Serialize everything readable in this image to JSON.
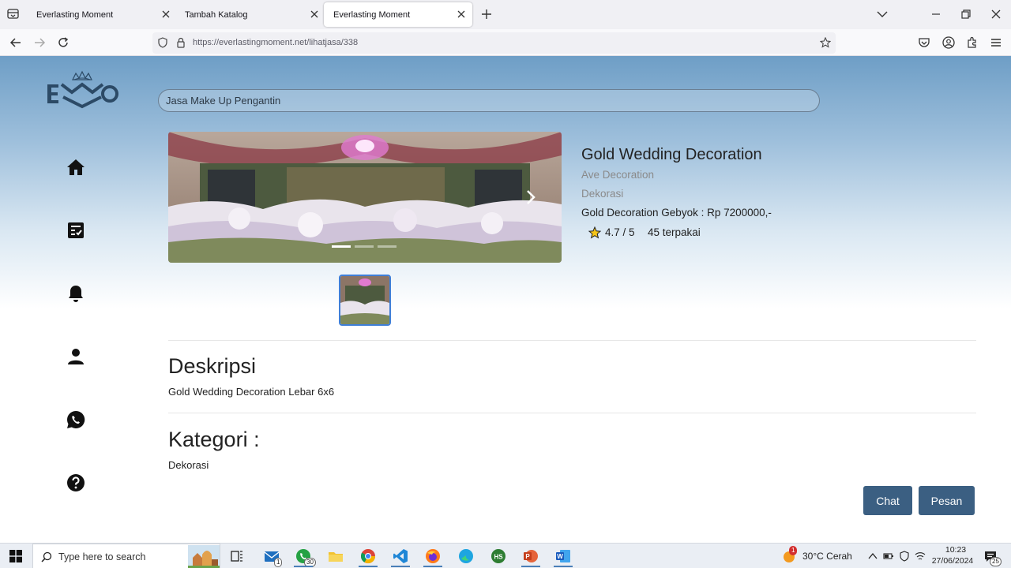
{
  "browser": {
    "tabs": [
      {
        "title": "Everlasting Moment"
      },
      {
        "title": "Tambah Katalog"
      },
      {
        "title": "Everlasting Moment"
      }
    ],
    "url": "https://everlastingmoment.net/lihatjasa/338"
  },
  "site": {
    "search_value": "Jasa Make Up Pengantin",
    "product": {
      "title": "Gold Wedding Decoration",
      "vendor": "Ave Decoration",
      "type": "Dekorasi",
      "price_line": "Gold Decoration Gebyok : Rp 7200000,-",
      "rating": "4.7 / 5",
      "used": "45 terpakai"
    },
    "description": {
      "heading": "Deskripsi",
      "text": "Gold Wedding Decoration Lebar 6x6"
    },
    "category": {
      "heading": "Kategori :",
      "text": "Dekorasi"
    },
    "buttons": {
      "chat": "Chat",
      "pesan": "Pesan"
    },
    "accent_color": "#3b5f82"
  },
  "taskbar": {
    "search_placeholder": "Type here to search",
    "badges": {
      "mail": "1",
      "whatsapp": "30",
      "weather_alert": "1",
      "notifications": "25"
    },
    "weather": "30°C  Cerah",
    "time": "10:23",
    "date": "27/06/2024"
  }
}
